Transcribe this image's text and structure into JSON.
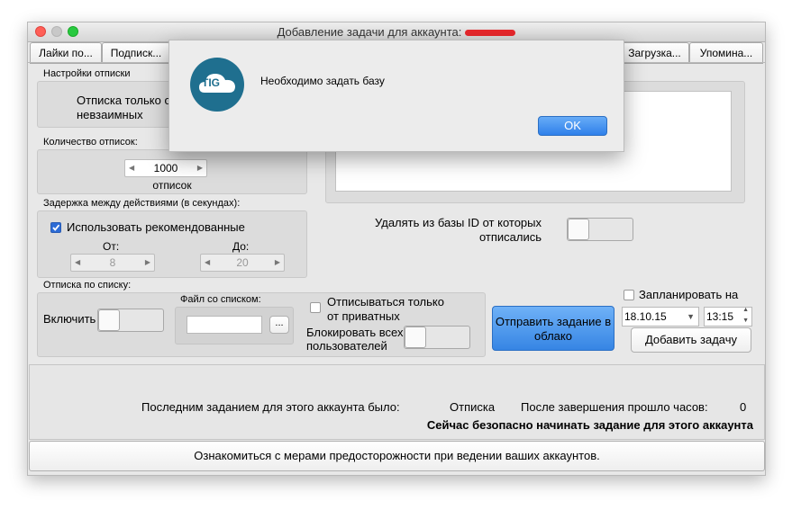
{
  "window": {
    "title": "Добавление задачи для аккаунта:",
    "tabs": [
      "Лайки по...",
      "Подписк...",
      "Загрузка...",
      "Упомина..."
    ]
  },
  "unfollow_settings": {
    "group_label": "Настройки отписки",
    "mode_line1": "Отписка только о",
    "mode_line2": "невзаимных"
  },
  "count": {
    "group_label": "Количество отписок:",
    "value": "1000",
    "unit": "отписок"
  },
  "delay": {
    "group_label": "Задержка между действиями (в секундах):",
    "use_recommended": "Использовать рекомендованные",
    "from_label": "От:",
    "from_value": "8",
    "to_label": "До:",
    "to_value": "20"
  },
  "list": {
    "group_label": "Отписка по списку:",
    "enable_label": "Включить",
    "file_label": "Файл со списком:",
    "browse": "...",
    "private_only_line1": "Отписываться только",
    "private_only_line2": "от приватных",
    "block_line1": "Блокировать всех",
    "block_line2": "пользователей"
  },
  "delete_from_db": {
    "line1": "Удалять из базы ID от которых",
    "line2": "отписались"
  },
  "actions": {
    "send_cloud_line1": "Отправить задание в",
    "send_cloud_line2": "облако",
    "schedule_label": "Запланировать на",
    "date": "18.10.15",
    "time": "13:15",
    "add_task": "Добавить задачу"
  },
  "status": {
    "last_task_label": "Последним заданием для этого аккаунта было:",
    "last_task_value": "Отписка",
    "hours_label": "После завершения прошло часов:",
    "hours_value": "0",
    "safe_msg": "Сейчас безопасно начинать задание для этого аккаунта"
  },
  "footer": {
    "link": "Ознакомиться с мерами предосторожности при ведении ваших аккаунтов."
  },
  "alert": {
    "logo": "TIG",
    "message": "Необходимо задать базу",
    "ok": "OK"
  },
  "colors": {
    "accent": "#3d8de6",
    "logo_bg": "#1f6f8f",
    "redaction": "#e8272c"
  }
}
